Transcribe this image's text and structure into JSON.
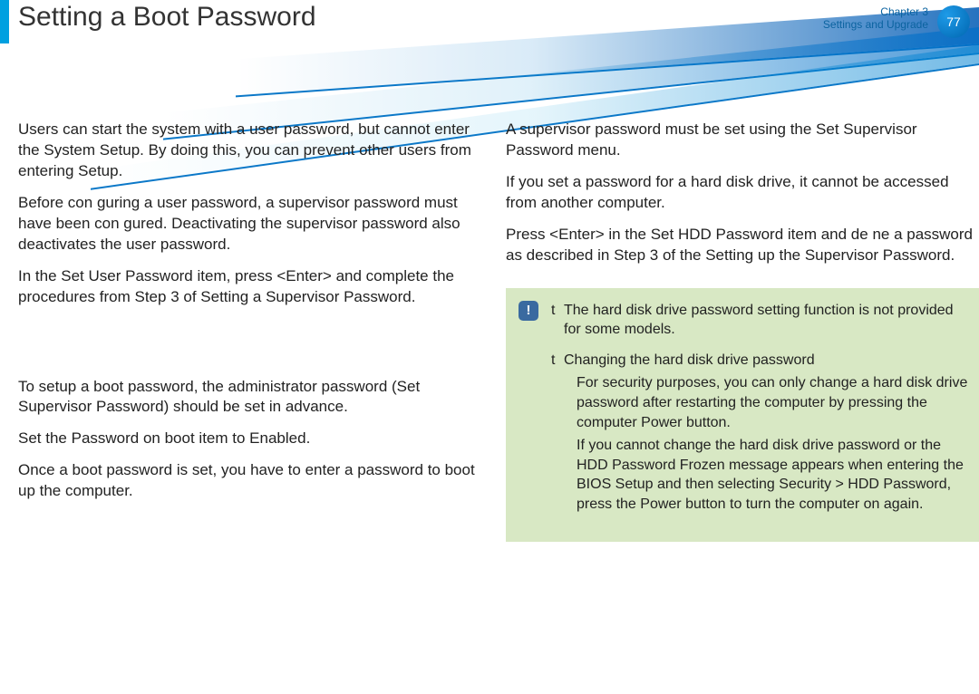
{
  "header": {
    "title": "Setting a Boot Password",
    "chapter_line1": "Chapter 3",
    "chapter_line2": "Settings and Upgrade",
    "page_number": "77"
  },
  "left_column": {
    "p1": "Users can start the system with a user password, but cannot enter the System Setup. By doing this, you can prevent other users from entering Setup.",
    "p2_a": "Before con guring a user password, a ",
    "p2_b": "supervisor password",
    "p2_c": " must have been con gured. Deactivating the supervisor password also deactivates the user password.",
    "p3_a": "In the ",
    "p3_b": "Set User Password",
    "p3_c": " item, press <",
    "p3_d": "Enter",
    "p3_e": "> and complete the procedures from Step 3 of Setting a Supervisor Password.",
    "p4_a": "To setup a boot password, the administrator password (",
    "p4_b": "Set Supervisor Password",
    "p4_c": ") should be set in advance.",
    "p5_a": "Set the ",
    "p5_b": "Password on boot",
    "p5_c": " item to ",
    "p5_d": "Enabled",
    "p5_e": ".",
    "p6": "Once a boot password is set, you have to enter a password to boot up the computer."
  },
  "right_column": {
    "p1": "A supervisor password must be set using the Set Supervisor Password menu.",
    "p2": "If you set a password for a hard disk drive, it cannot be accessed from another computer.",
    "p3_a": "Press <",
    "p3_b": "Enter",
    "p3_c": "> in the ",
    "p3_d": "Set HDD Password",
    "p3_e": " item and de ne a password as described in Step 3 of the Setting up the Supervisor Password."
  },
  "note": {
    "icon": "!",
    "bullet": "t",
    "item1": "The hard disk drive password setting function is not provided for some models.",
    "item2_title": "Changing the hard disk drive password",
    "item2_p1_a": "For security purposes, you can only change a hard disk drive password after restarting the computer by pressing the computer ",
    "item2_p1_b": "Power",
    "item2_p1_c": " button.",
    "item2_p2_a": "If you cannot change the hard disk drive password or the ",
    "item2_p2_b": "HDD Password Frozen",
    "item2_p2_c": " message appears when entering the BIOS Setup and then selecting ",
    "item2_p2_d": "Security > HDD Password",
    "item2_p2_e": ", press the ",
    "item2_p2_f": "Power",
    "item2_p2_g": " button to turn the computer on again."
  }
}
